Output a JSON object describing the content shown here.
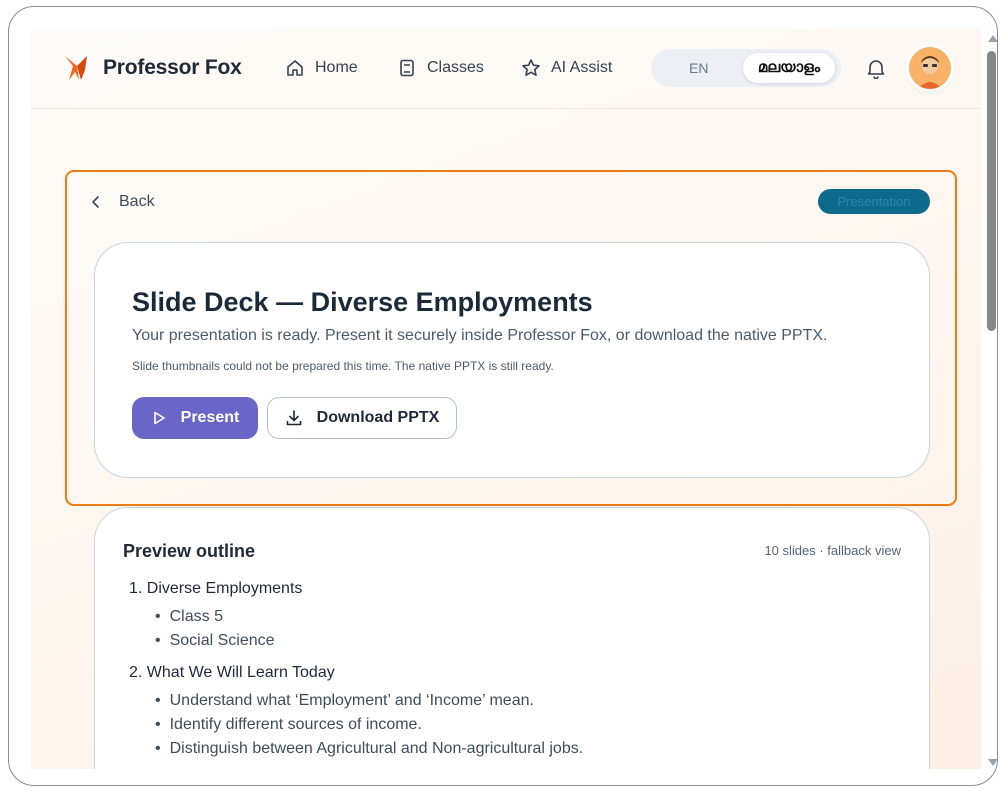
{
  "header": {
    "brand": "Professor Fox",
    "nav": [
      {
        "label": "Home",
        "icon": "home-icon"
      },
      {
        "label": "Classes",
        "icon": "book-icon"
      },
      {
        "label": "AI Assist",
        "icon": "star-icon"
      }
    ],
    "lang_en": "EN",
    "lang_ml": "മലയാളം",
    "notification_icon": "bell-icon",
    "avatar_icon": "user-avatar"
  },
  "panel": {
    "back_label": "Back",
    "tag": "Presentation",
    "title": "Slide Deck — Diverse Employments",
    "subtitle": "Your presentation is ready. Present it securely inside Professor Fox, or download the native PPTX.",
    "note": "Slide thumbnails could not be prepared this time. The native PPTX is still ready.",
    "present_label": "Present",
    "download_label": "Download PPTX"
  },
  "outline": {
    "title": "Preview outline",
    "meta": "10 slides · fallback view",
    "slides": [
      {
        "heading": "1. Diverse Employments",
        "bullets": [
          "Class 5",
          "Social Science"
        ]
      },
      {
        "heading": "2. What We Will Learn Today",
        "bullets": [
          "Understand what ‘Employment’ and ‘Income’ mean.",
          "Identify different sources of income.",
          "Distinguish between Agricultural and Non-agricultural jobs."
        ]
      }
    ]
  },
  "colors": {
    "accent": "#6a66c7",
    "highlight": "#f07b14",
    "tag_bg": "#0e6a8c"
  }
}
